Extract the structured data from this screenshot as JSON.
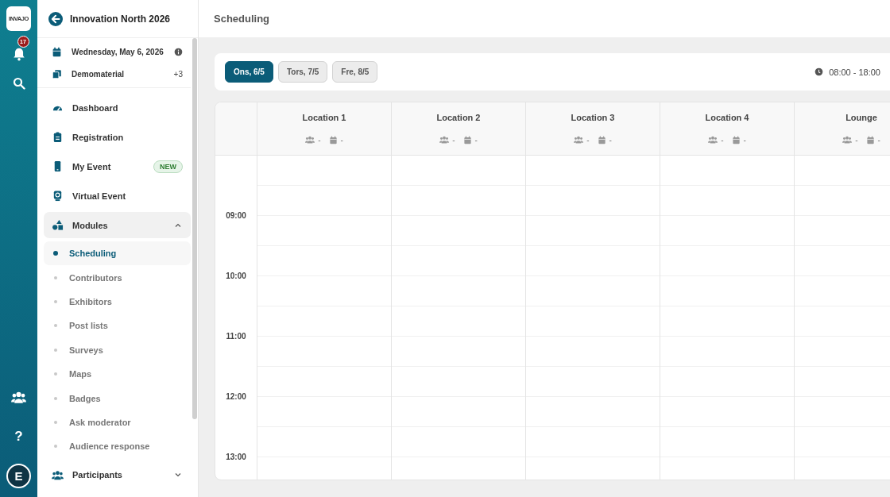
{
  "rail": {
    "logo": "INVAJO",
    "notifications": "17",
    "help": "?",
    "avatar": "E"
  },
  "sidebar": {
    "title": "Innovation North 2026",
    "date": "Wednesday, May 6, 2026",
    "material": "Demomaterial",
    "material_count": "+3",
    "items": [
      {
        "label": "Dashboard"
      },
      {
        "label": "Registration"
      },
      {
        "label": "My Event",
        "badge": "NEW"
      },
      {
        "label": "Virtual Event"
      },
      {
        "label": "Modules",
        "expanded": true,
        "children": [
          {
            "label": "Scheduling",
            "selected": true
          },
          {
            "label": "Contributors",
            "selected": false
          },
          {
            "label": "Exhibitors",
            "selected": false
          },
          {
            "label": "Post lists",
            "selected": false
          },
          {
            "label": "Surveys",
            "selected": false
          },
          {
            "label": "Maps",
            "selected": false
          },
          {
            "label": "Badges",
            "selected": false
          },
          {
            "label": "Ask moderator",
            "selected": false
          },
          {
            "label": "Audience response",
            "selected": false
          }
        ]
      },
      {
        "label": "Participants",
        "expanded": false
      }
    ]
  },
  "header": {
    "title": "Scheduling"
  },
  "days": [
    {
      "label": "Ons, 6/5",
      "selected": true
    },
    {
      "label": "Tors, 7/5",
      "selected": false
    },
    {
      "label": "Fre, 8/5",
      "selected": false
    }
  ],
  "time_range": "08:00 - 18:00",
  "locations": [
    {
      "name": "Location 1",
      "people": "-",
      "sessions": "-"
    },
    {
      "name": "Location 2",
      "people": "-",
      "sessions": "-"
    },
    {
      "name": "Location 3",
      "people": "-",
      "sessions": "-"
    },
    {
      "name": "Location 4",
      "people": "-",
      "sessions": "-"
    },
    {
      "name": "Lounge",
      "people": "-",
      "sessions": "-"
    }
  ],
  "times": [
    "09:00",
    "10:00",
    "11:00",
    "12:00",
    "13:00"
  ]
}
